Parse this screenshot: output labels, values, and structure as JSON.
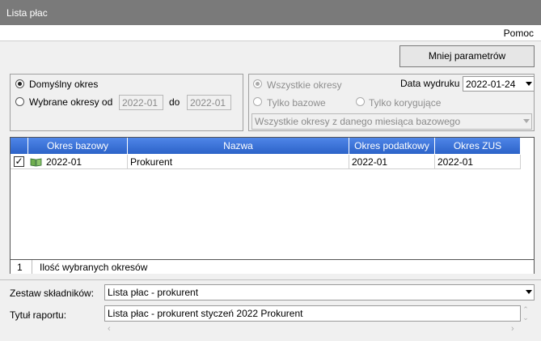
{
  "window": {
    "title": "Lista płac"
  },
  "menu": {
    "help": "Pomoc"
  },
  "toolbar": {
    "less_params_label": "Mniej parametrów"
  },
  "period": {
    "default_label": "Domyślny  okres",
    "selected_label": "Wybrane okresy od",
    "from_value": "2022-01",
    "to_label": "do",
    "to_value": "2022-01",
    "mode": "default"
  },
  "filters": {
    "all_periods_label": "Wszystkie okresy",
    "base_only_label": "Tylko bazowe",
    "corrective_only_label": "Tylko korygujące",
    "print_date_label": "Data wydruku",
    "print_date_value": "2022-01-24",
    "scope_value": "Wszystkie okresy z danego miesiąca bazowego"
  },
  "grid": {
    "columns": [
      "Okres bazowy",
      "Nazwa",
      "Okres podatkowy",
      "Okres ZUS"
    ],
    "rows": [
      {
        "checked": true,
        "base_period": "2022-01",
        "name": "Prokurent",
        "tax_period": "2022-01",
        "zus_period": "2022-01"
      }
    ],
    "footer_count": "1",
    "footer_label": "Ilość wybranych okresów"
  },
  "report": {
    "components_label": "Zestaw składników:",
    "components_value": "Lista płac - prokurent",
    "title_label": "Tytuł raportu:",
    "title_value": "Lista płac - prokurent styczeń 2022 Prokurent"
  },
  "colors": {
    "titlebar": "#7a7a7a",
    "grid_header": "#3a72d8"
  }
}
